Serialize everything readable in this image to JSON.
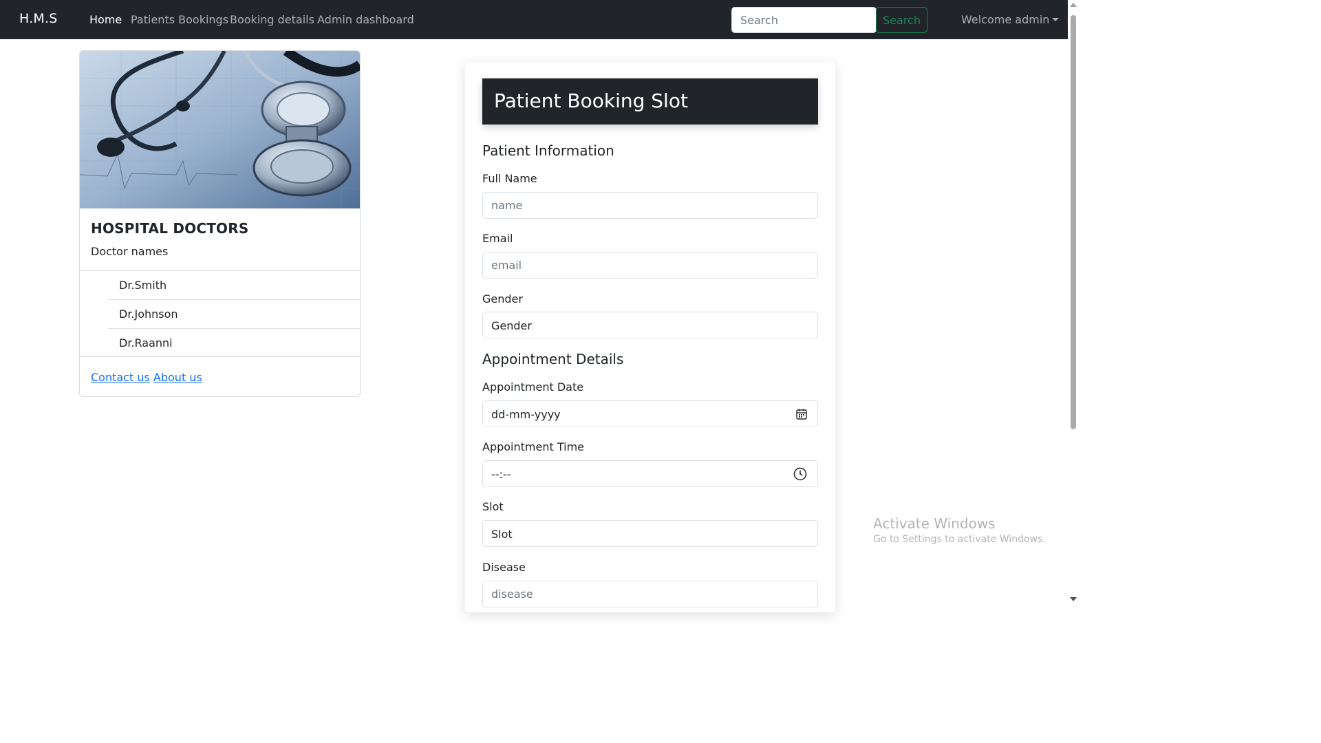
{
  "navbar": {
    "brand": "H.M.S",
    "links": [
      "Home",
      "Patients Bookings",
      "Booking details",
      "Admin dashboard"
    ],
    "search_placeholder": "Search",
    "search_button": "Search",
    "welcome": "Welcome admin"
  },
  "doctors_card": {
    "title": "HOSPITAL DOCTORS",
    "subtitle": "Doctor names",
    "doctors": [
      "Dr.Smith",
      "Dr.Johnson",
      "Dr.Raanni"
    ],
    "links": [
      "Contact us",
      "About us"
    ]
  },
  "booking_form": {
    "title": "Patient Booking Slot",
    "patient_section": "Patient Information",
    "full_name_label": "Full Name",
    "full_name_placeholder": "name",
    "email_label": "Email",
    "email_placeholder": "email",
    "gender_label": "Gender",
    "gender_value": "Gender",
    "appointment_section": "Appointment Details",
    "date_label": "Appointment Date",
    "date_placeholder": "dd-mm-yyyy",
    "time_label": "Appointment Time",
    "time_placeholder": "--:--",
    "slot_label": "Slot",
    "slot_value": "Slot",
    "disease_label": "Disease",
    "disease_placeholder": "disease"
  },
  "watermark": {
    "line1": "Activate Windows",
    "line2": "Go to Settings to activate Windows."
  },
  "icons": {
    "calendar": "calendar-icon",
    "clock": "clock-icon",
    "dropdown": "caret-down-icon",
    "stethoscope_image": "stethoscope-image"
  },
  "colors": {
    "navbar_bg": "#212529",
    "success": "#198754",
    "link": "#0d6efd"
  }
}
